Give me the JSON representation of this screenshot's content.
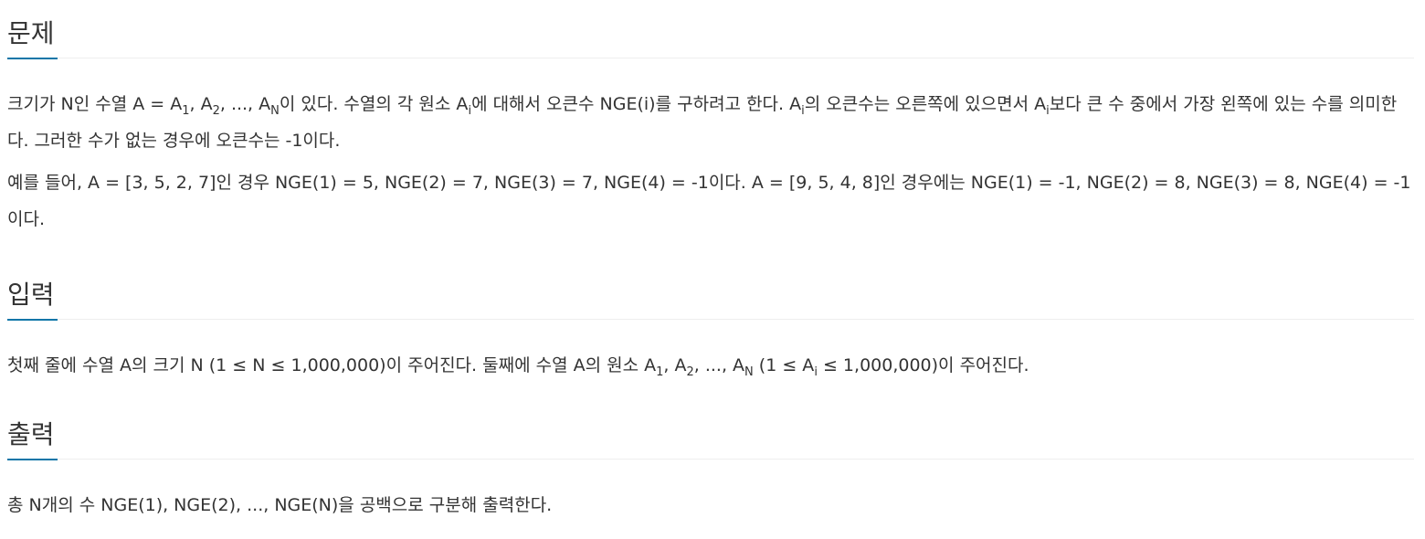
{
  "problem": {
    "title": "문제",
    "p1": {
      "t1": "크기가 N인 수열 A = A",
      "s1": "1",
      "t2": ", A",
      "s2": "2",
      "t3": ", ..., A",
      "s3": "N",
      "t4": "이 있다. 수열의 각 원소 A",
      "s4": "i",
      "t5": "에 대해서 오큰수 NGE(i)를 구하려고 한다. A",
      "s5": "i",
      "t6": "의 오큰수는 오른쪽에 있으면서 A",
      "s6": "i",
      "t7": "보다 큰 수 중에서 가장 왼쪽에 있는 수를 의미한다. 그러한 수가 없는 경우에 오큰수는 -1이다."
    },
    "p2": "예를 들어, A = [3, 5, 2, 7]인 경우 NGE(1) = 5, NGE(2) = 7, NGE(3) = 7, NGE(4) = -1이다. A = [9, 5, 4, 8]인 경우에는 NGE(1) = -1, NGE(2) = 8, NGE(3) = 8, NGE(4) = -1이다."
  },
  "input": {
    "title": "입력",
    "p1": {
      "t1": "첫째 줄에 수열 A의 크기 N (1 ≤ N ≤ 1,000,000)이 주어진다. 둘째에 수열 A의 원소 A",
      "s1": "1",
      "t2": ", A",
      "s2": "2",
      "t3": ", ..., A",
      "s3": "N",
      "t4": " (1 ≤ A",
      "s4": "i",
      "t5": " ≤ 1,000,000)이 주어진다."
    }
  },
  "output": {
    "title": "출력",
    "p1": "총 N개의 수 NGE(1), NGE(2), ..., NGE(N)을 공백으로 구분해 출력한다."
  },
  "colors": {
    "accent": "#0e76a8",
    "text": "#333333",
    "divider": "#eeeeee"
  }
}
